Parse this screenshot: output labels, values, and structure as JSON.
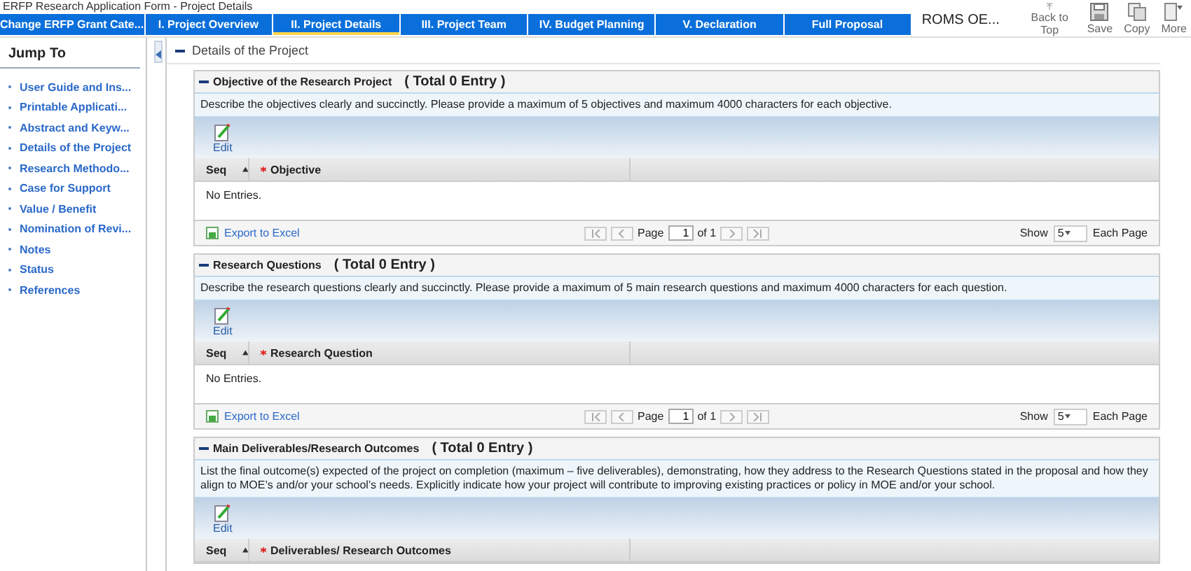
{
  "window": {
    "title": "ERFP Research Application Form - Project Details"
  },
  "tabs": [
    {
      "label": "Change ERFP Grant Cate...",
      "selected": false
    },
    {
      "label": "I. Project Overview",
      "selected": false
    },
    {
      "label": "II. Project Details",
      "selected": true
    },
    {
      "label": "III. Project Team",
      "selected": false
    },
    {
      "label": "IV. Budget Planning",
      "selected": false
    },
    {
      "label": "V. Declaration",
      "selected": false
    },
    {
      "label": "Full Proposal",
      "selected": false
    }
  ],
  "user_label": "ROMS OE...",
  "toolbar": [
    {
      "kind": "top",
      "label": "Back to Top"
    },
    {
      "kind": "save",
      "label": "Save"
    },
    {
      "kind": "copy",
      "label": "Copy"
    },
    {
      "kind": "more",
      "label": "More"
    }
  ],
  "sidebar": {
    "title": "Jump To",
    "items": [
      {
        "label": "User Guide and Ins..."
      },
      {
        "label": "Printable Applicati..."
      },
      {
        "label": "Abstract and Keyw..."
      },
      {
        "label": "Details of the Project"
      },
      {
        "label": "Research Methodo..."
      },
      {
        "label": "Case for Support"
      },
      {
        "label": "Value / Benefit"
      },
      {
        "label": "Nomination of Revi..."
      },
      {
        "label": "Notes"
      },
      {
        "label": "Status"
      },
      {
        "label": "References"
      }
    ]
  },
  "section": {
    "title": "Details of the Project"
  },
  "panels": [
    {
      "title": "Objective of the Research Project",
      "total": "( Total 0 Entry )",
      "description": "Describe the objectives clearly and succinctly. Please provide a maximum of 5 objectives and maximum 4000 characters for each objective.",
      "edit_label": "Edit",
      "columns": [
        {
          "label": "Seq",
          "required": false,
          "sorted": true
        },
        {
          "label": "Objective",
          "required": true,
          "sorted": false
        }
      ],
      "empty_text": "No Entries.",
      "footer": {
        "export_label": "Export to Excel",
        "page_label": "Page",
        "page": "1",
        "of_label": "of 1",
        "show_label": "Show",
        "page_size": "5",
        "each_label": "Each Page"
      }
    },
    {
      "title": "Research Questions",
      "total": "( Total 0 Entry )",
      "description": "Describe the research questions clearly and succinctly. Please provide a maximum of 5 main research questions and maximum 4000 characters for each question.",
      "edit_label": "Edit",
      "columns": [
        {
          "label": "Seq",
          "required": false,
          "sorted": true
        },
        {
          "label": "Research Question",
          "required": true,
          "sorted": false
        }
      ],
      "empty_text": "No Entries.",
      "footer": {
        "export_label": "Export to Excel",
        "page_label": "Page",
        "page": "1",
        "of_label": "of 1",
        "show_label": "Show",
        "page_size": "5",
        "each_label": "Each Page"
      }
    },
    {
      "title": "Main Deliverables/Research Outcomes",
      "total": "( Total 0 Entry )",
      "description": "List the final outcome(s) expected of the project on completion (maximum – five deliverables), demonstrating, how they address to the Research Questions stated in the proposal and how they align to MOE’s and/or your school’s needs. Explicitly indicate how your project will contribute to improving existing practices or policy in MOE and/or your school.",
      "edit_label": "Edit",
      "columns": [
        {
          "label": "Seq",
          "required": false,
          "sorted": true
        },
        {
          "label": "Deliverables/ Research Outcomes",
          "required": true,
          "sorted": false
        }
      ]
    }
  ]
}
